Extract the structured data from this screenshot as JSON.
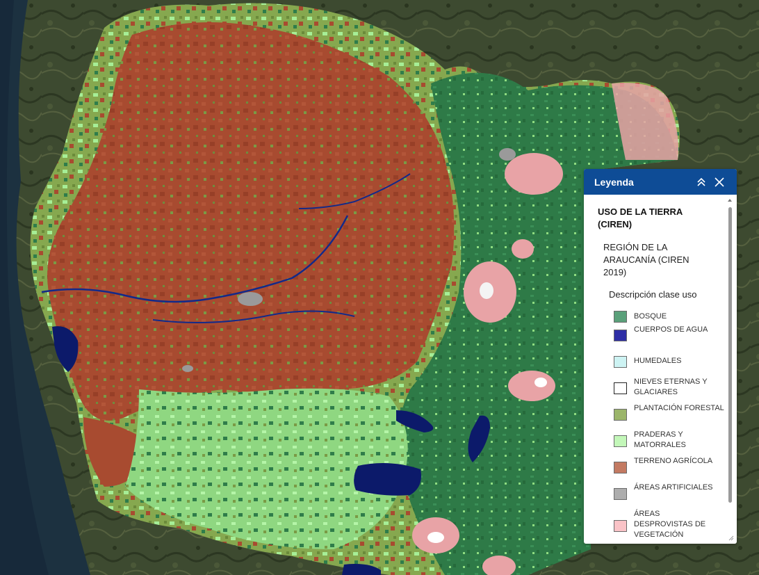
{
  "legend": {
    "title": "Leyenda",
    "layer_title": "USO DE LA TIERRA (CIREN)",
    "sublayer_title": "REGIÓN DE LA ARAUCANÍA (CIREN 2019)",
    "field_title": "Descripción clase uso",
    "items": [
      {
        "label": "BOSQUE",
        "color": "#5aa07a"
      },
      {
        "label": "CUERPOS DE AGUA",
        "color": "#2e2ea6"
      },
      {
        "label": "HUMEDALES",
        "color": "#cdf3f3"
      },
      {
        "label": "NIEVES ETERNAS Y GLACIARES",
        "color": "#ffffff"
      },
      {
        "label": "PLANTACIÓN FORESTAL",
        "color": "#9bb56a"
      },
      {
        "label": "PRADERAS Y MATORRALES",
        "color": "#c3f7b9"
      },
      {
        "label": "TERRENO AGRÍCOLA",
        "color": "#c37a62"
      },
      {
        "label": "ÁREAS ARTIFICIALES",
        "color": "#adadad"
      },
      {
        "label": "ÁREAS DESPROVISTAS DE VEGETACIÓN",
        "color": "#fac3c7"
      }
    ]
  },
  "icons": {
    "collapse": "chevron-up-double-icon",
    "close": "close-icon",
    "resize": "resize-grip-icon"
  },
  "map_colors": {
    "ocean": "#1e3340",
    "terrain": "#3d4a30",
    "forest": "#2f7d4a",
    "agricultural": "#a64a30",
    "plantation": "#7a9a45",
    "meadow": "#9be889",
    "water": "#0c1a6a",
    "bare": "#e8a3a6",
    "urban": "#9a9a9a"
  }
}
